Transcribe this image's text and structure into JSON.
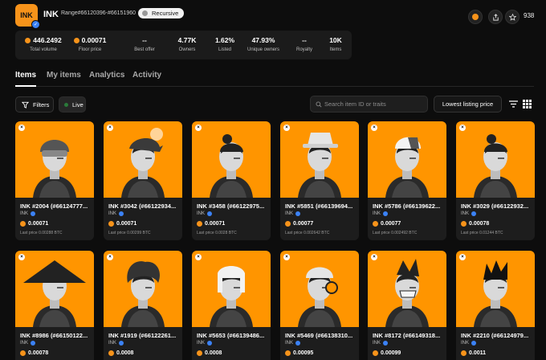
{
  "collection": {
    "name": "INK",
    "logo_text": "INK",
    "range": "Range#66120396-#66151960",
    "badge": "Recursive",
    "favorites": "938"
  },
  "stats": [
    {
      "value": "446.2492",
      "label": "Total volume",
      "btc": true
    },
    {
      "value": "0.00071",
      "label": "Floor price",
      "btc": true
    },
    {
      "value": "--",
      "label": "Best offer",
      "btc": false
    },
    {
      "value": "4.77K",
      "label": "Owners",
      "btc": false
    },
    {
      "value": "1.62%",
      "label": "Listed",
      "btc": false
    },
    {
      "value": "47.93%",
      "label": "Unique owners",
      "btc": false
    },
    {
      "value": "--",
      "label": "Royalty",
      "btc": false
    },
    {
      "value": "10K",
      "label": "Items",
      "btc": false
    }
  ],
  "tabs": [
    "Items",
    "My items",
    "Analytics",
    "Activity"
  ],
  "toolbar": {
    "filters": "Filters",
    "live": "Live",
    "search_placeholder": "Search item ID or traits",
    "sort": "Lowest listing price"
  },
  "items": [
    {
      "title": "INK #2004 (#66124777...",
      "collection": "INK",
      "price": "0.00071",
      "last": "Last price 0.00288 BTC"
    },
    {
      "title": "INK #3042 (#66122934...",
      "collection": "INK",
      "price": "0.00071",
      "last": "Last price 0.00299 BTC"
    },
    {
      "title": "INK #3458 (#66122975...",
      "collection": "INK",
      "price": "0.00071",
      "last": "Last price 0.0028 BTC"
    },
    {
      "title": "INK #5851 (#66139694...",
      "collection": "INK",
      "price": "0.00077",
      "last": "Last price 0.002642 BTC"
    },
    {
      "title": "INK #5786 (#66139622...",
      "collection": "INK",
      "price": "0.00077",
      "last": "Last price 0.002492 BTC"
    },
    {
      "title": "INK #3029 (#66122932...",
      "collection": "INK",
      "price": "0.00078",
      "last": "Last price 0.01244 BTC"
    },
    {
      "title": "INK #8986 (#66150122...",
      "collection": "INK",
      "price": "0.00078",
      "last": ""
    },
    {
      "title": "INK #1919 (#66122261...",
      "collection": "INK",
      "price": "0.0008",
      "last": ""
    },
    {
      "title": "INK #5653 (#66139486...",
      "collection": "INK",
      "price": "0.0008",
      "last": ""
    },
    {
      "title": "INK #5469 (#66138310...",
      "collection": "INK",
      "price": "0.00095",
      "last": ""
    },
    {
      "title": "INK #8172 (#66149318...",
      "collection": "INK",
      "price": "0.00099",
      "last": ""
    },
    {
      "title": "INK #2210 (#66124979...",
      "collection": "INK",
      "price": "0.0011",
      "last": ""
    }
  ],
  "colors": {
    "accent": "#ff9500",
    "btc": "#f7931a",
    "verify": "#3b82f6"
  }
}
